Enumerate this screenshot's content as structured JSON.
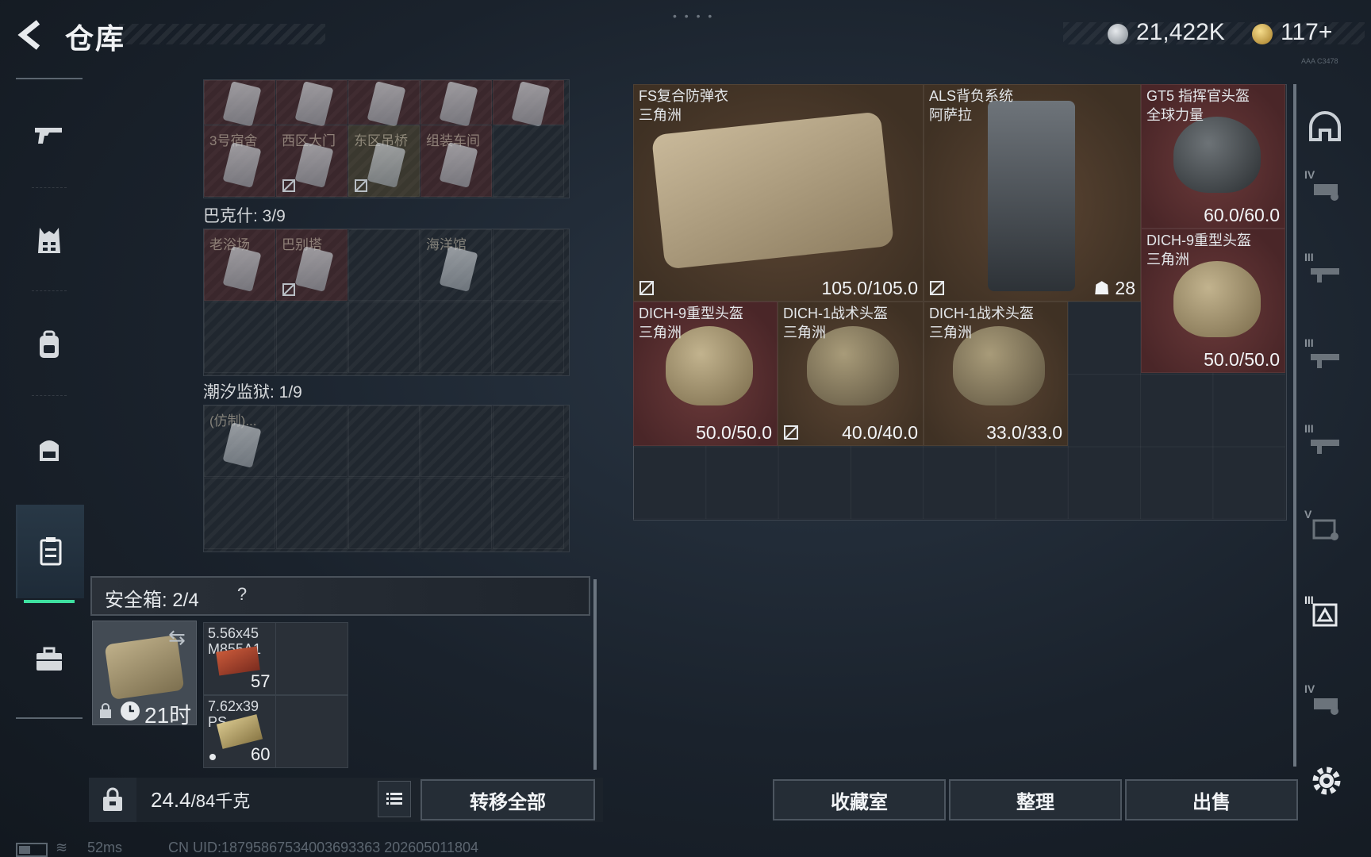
{
  "header": {
    "title": "仓库",
    "currency_silver": "21,422K",
    "currency_gold": "117+",
    "drag_handle": "• • • •",
    "tiny_label": "AAA C3478"
  },
  "nav": {
    "items": [
      {
        "name": "weapons"
      },
      {
        "name": "armor"
      },
      {
        "name": "backpack"
      },
      {
        "name": "chest-rig"
      },
      {
        "name": "case",
        "active": true
      },
      {
        "name": "toolbox"
      }
    ],
    "accent": "#3ee0a0"
  },
  "keys": {
    "top_row_labels": [
      "",
      "",
      "",
      "",
      ""
    ],
    "row2_labels": [
      "3号宿舍",
      "西区大门",
      "东区吊桥",
      "组装车间",
      ""
    ],
    "bakesh_title": "巴克什: 3/9",
    "bakesh_labels": [
      "老浴场",
      "巴别塔",
      "",
      "海洋馆",
      ""
    ],
    "tide_title": "潮汐监狱: 1/9",
    "tide_labels": [
      "(仿制)..."
    ]
  },
  "safe_box": {
    "label": "安全箱: 2/4",
    "help": "?",
    "timer": "21时",
    "swap_icon": "⇆",
    "ammo": [
      {
        "name_line1": "5.56x45",
        "name_line2": "M855A1",
        "count": "57"
      },
      {
        "name_line1": "7.62x39",
        "name_line2": "PS",
        "count": "60"
      }
    ]
  },
  "bottom_left": {
    "weight_current": "24.4",
    "weight_max": "/84千克",
    "transfer_all": "转移全部"
  },
  "equipment": [
    {
      "name": "FS复合防弹衣",
      "sub": "三角洲",
      "durability": "105.0/105.0",
      "color": "brown"
    },
    {
      "name": "ALS背负系统",
      "sub": "阿萨拉",
      "count": "28",
      "color": "brown"
    },
    {
      "name": "GT5 指挥官头盔",
      "sub": "全球力量",
      "durability": "60.0/60.0",
      "color": "red"
    },
    {
      "name": "DICH-9重型头盔",
      "sub": "三角洲",
      "durability": "50.0/50.0",
      "color": "red"
    },
    {
      "name": "DICH-9重型头盔",
      "sub": "三角洲",
      "durability": "50.0/50.0",
      "color": "red"
    },
    {
      "name": "DICH-1战术头盔",
      "sub": "三角洲",
      "durability": "40.0/40.0",
      "color": "brown"
    },
    {
      "name": "DICH-1战术头盔",
      "sub": "三角洲",
      "durability": "33.0/33.0",
      "color": "brown"
    }
  ],
  "bottom_right": {
    "collection": "收藏室",
    "sort": "整理",
    "sell": "出售"
  },
  "rail": {
    "tiers": [
      "IV",
      "III",
      "III",
      "III",
      "V",
      "III",
      "IV"
    ]
  },
  "status": {
    "ping": "52ms",
    "uid": "CN UID:18795867534003693363 202605011804",
    "wifi": "≋"
  }
}
